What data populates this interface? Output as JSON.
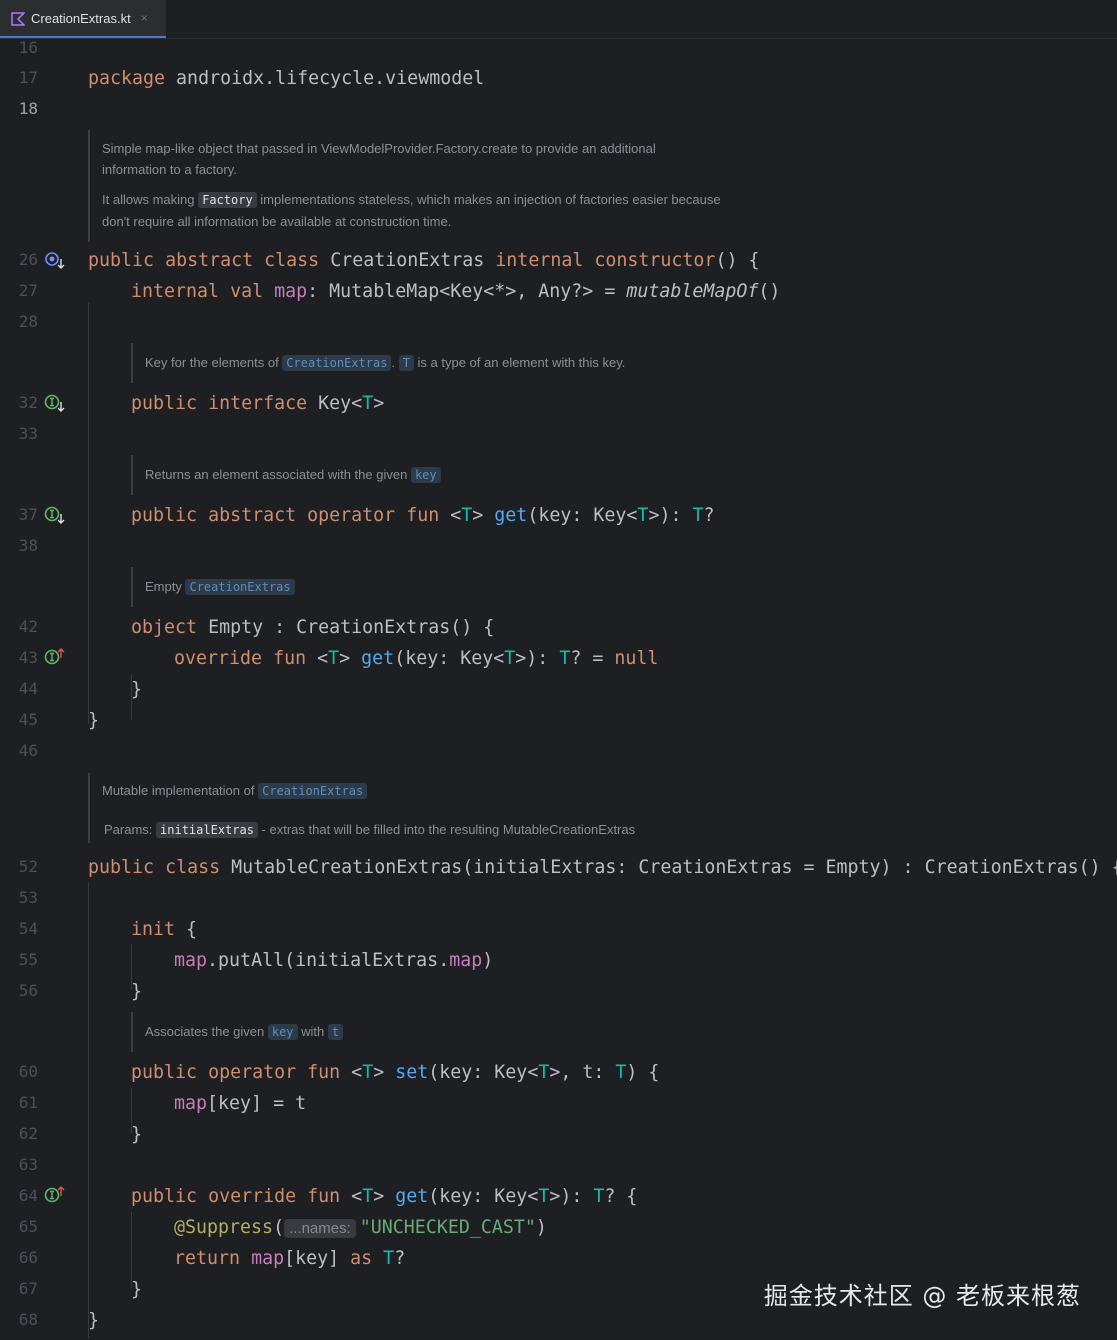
{
  "tab": {
    "filename": "CreationExtras.kt",
    "close_glyph": "×"
  },
  "lines": {
    "l16": "16",
    "l17": "17",
    "l18": "18",
    "l26": "26",
    "l27": "27",
    "l28": "28",
    "l32": "32",
    "l33": "33",
    "l37": "37",
    "l38": "38",
    "l42": "42",
    "l43": "43",
    "l44": "44",
    "l45": "45",
    "l46": "46",
    "l52": "52",
    "l53": "53",
    "l54": "54",
    "l55": "55",
    "l56": "56",
    "l60": "60",
    "l61": "61",
    "l62": "62",
    "l63": "63",
    "l64": "64",
    "l65": "65",
    "l66": "66",
    "l67": "67",
    "l68": "68"
  },
  "code": {
    "package_kw": "package",
    "package_name": " androidx.lifecycle.viewmodel",
    "public": "public",
    "abstract": "abstract",
    "class": "class",
    "internal": "internal",
    "constructor": "constructor",
    "val": "val",
    "interface": "interface",
    "operator": "operator",
    "fun": "fun",
    "object": "object",
    "override": "override",
    "null": "null",
    "init": "init",
    "return": "return",
    "as": "as",
    "creation_extras": "CreationExtras",
    "map": "map",
    "mutable_map_type": ": MutableMap<Key<*>, Any?> = ",
    "mutable_map_of": "mutableMapOf",
    "parens_open": "() {",
    "parens": "()",
    "key_type": "Key",
    "T": "T",
    "get": "get",
    "set": "set",
    "empty": "Empty",
    "mutable_creation_extras": "MutableCreationExtras",
    "initial_extras": "initialExtras",
    "put_all": "putAll",
    "suppress": "@Suppress",
    "unchecked_cast": "\"UNCHECKED_CAST\"",
    "param_hint": "...names:"
  },
  "docs": {
    "class_doc_1a": "Simple map-like object that passed in ViewModelProvider.Factory.create to provide an additional",
    "class_doc_1b": "information to a factory.",
    "class_doc_2a_pre": "It allows making ",
    "class_doc_2a_chip": "Factory",
    "class_doc_2a_post": " implementations stateless, which makes an injection of factories easier because",
    "class_doc_2b": "don't require all information be available at construction time.",
    "key_doc_pre": "Key for the elements of ",
    "key_doc_chip1": "CreationExtras",
    "key_doc_mid": ". ",
    "key_doc_chip2": "T",
    "key_doc_post": " is a type of an element with this key.",
    "get_doc_pre": "Returns an element associated with the given ",
    "get_doc_chip": "key",
    "empty_doc_pre": "Empty ",
    "empty_doc_chip": "CreationExtras",
    "mutable_doc_pre": "Mutable implementation of ",
    "mutable_doc_chip": "CreationExtras",
    "params_label": "Params: ",
    "params_chip": "initialExtras",
    "params_post": " - extras that will be filled into the resulting MutableCreationExtras",
    "assoc_pre": "Associates the given ",
    "assoc_chip1": "key",
    "assoc_mid": " with ",
    "assoc_chip2": "t"
  },
  "watermark": "掘金技术社区 @ 老板来根葱"
}
